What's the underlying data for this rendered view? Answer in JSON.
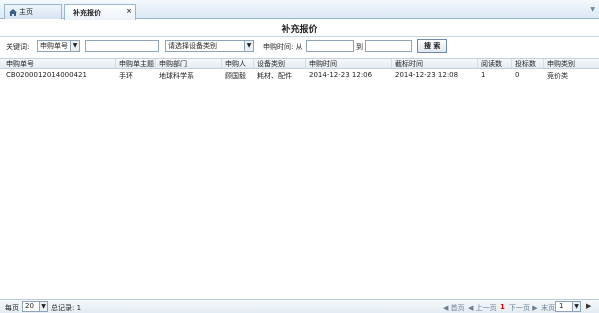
{
  "tabs": {
    "home_label": "主页",
    "active_label": "补充报价",
    "close_glyph": "×",
    "scroll_glyph": "▼"
  },
  "page": {
    "title": "补充报价"
  },
  "search": {
    "keyword_label": "关键词:",
    "keyword_select": "申购单号",
    "category_select": "请选择设备类别",
    "time_label": "申购时间: 从",
    "to_label": "到",
    "search_button": "搜 索"
  },
  "grid": {
    "columns": [
      "申购单号",
      "申购单主题",
      "申购部门",
      "申购人",
      "设备类别",
      "申购时间",
      "截标时间",
      "阅读数",
      "投标数",
      "申购类别"
    ],
    "rows": [
      [
        "CB0200012014000421",
        "手环",
        "地球科学系",
        "顾国毅",
        "耗材、配件",
        "2014-12-23 12:06",
        "2014-12-23 12:08",
        "1",
        "0",
        "竞价类"
      ]
    ]
  },
  "footer": {
    "per_page_label": "每页",
    "per_page_value": "20",
    "total_label": "总记录: 1",
    "first": "◀ 首页",
    "prev": "◀ 上一页",
    "current_page": "1",
    "next": "下一页 ▶",
    "last": "末页 ▶|",
    "page_input": "1",
    "go_glyph": "▶"
  },
  "colors": {
    "accent": "#9cb6cf",
    "header_bg": "#e3ebf3",
    "current_page": "#dd0000"
  }
}
